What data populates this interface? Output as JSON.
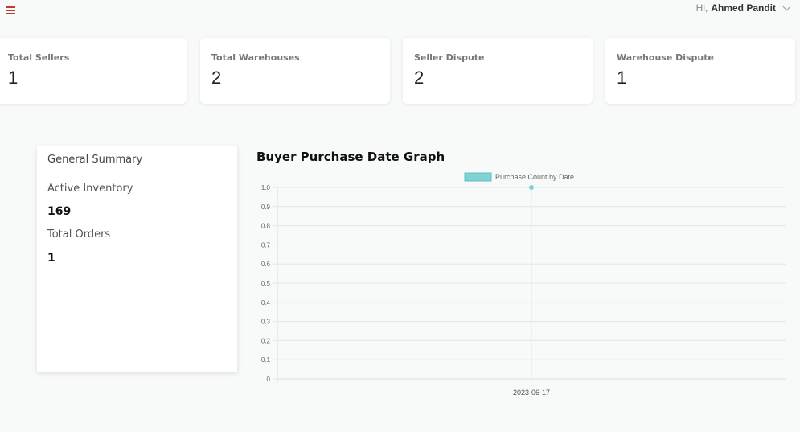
{
  "header": {
    "greeting": "Hi,",
    "user_name": "Ahmed Pandit",
    "menu_icon": "hamburger-menu-icon",
    "dropdown_icon": "chevron-down-icon",
    "accent_color": "#c0392b"
  },
  "stats": [
    {
      "label": "Total Sellers",
      "value": "1"
    },
    {
      "label": "Total Warehouses",
      "value": "2"
    },
    {
      "label": "Seller Dispute",
      "value": "2"
    },
    {
      "label": "Warehouse Dispute",
      "value": "1"
    }
  ],
  "summary": {
    "title": "General Summary",
    "active_inventory_label": "Active Inventory",
    "active_inventory_value": "169",
    "total_orders_label": "Total Orders",
    "total_orders_value": "1"
  },
  "chart_title": "Buyer Purchase Date Graph",
  "chart_data": {
    "type": "line",
    "x": [
      "2023-06-17"
    ],
    "series": [
      {
        "name": "Purchase Count by Date",
        "values": [
          1
        ],
        "color": "#7fd3d3"
      }
    ],
    "ylim": [
      0,
      1
    ],
    "yticks": [
      "0",
      "0.1",
      "0.2",
      "0.3",
      "0.4",
      "0.5",
      "0.6",
      "0.7",
      "0.8",
      "0.9",
      "1.0"
    ],
    "legend": "top-center",
    "grid": true
  }
}
